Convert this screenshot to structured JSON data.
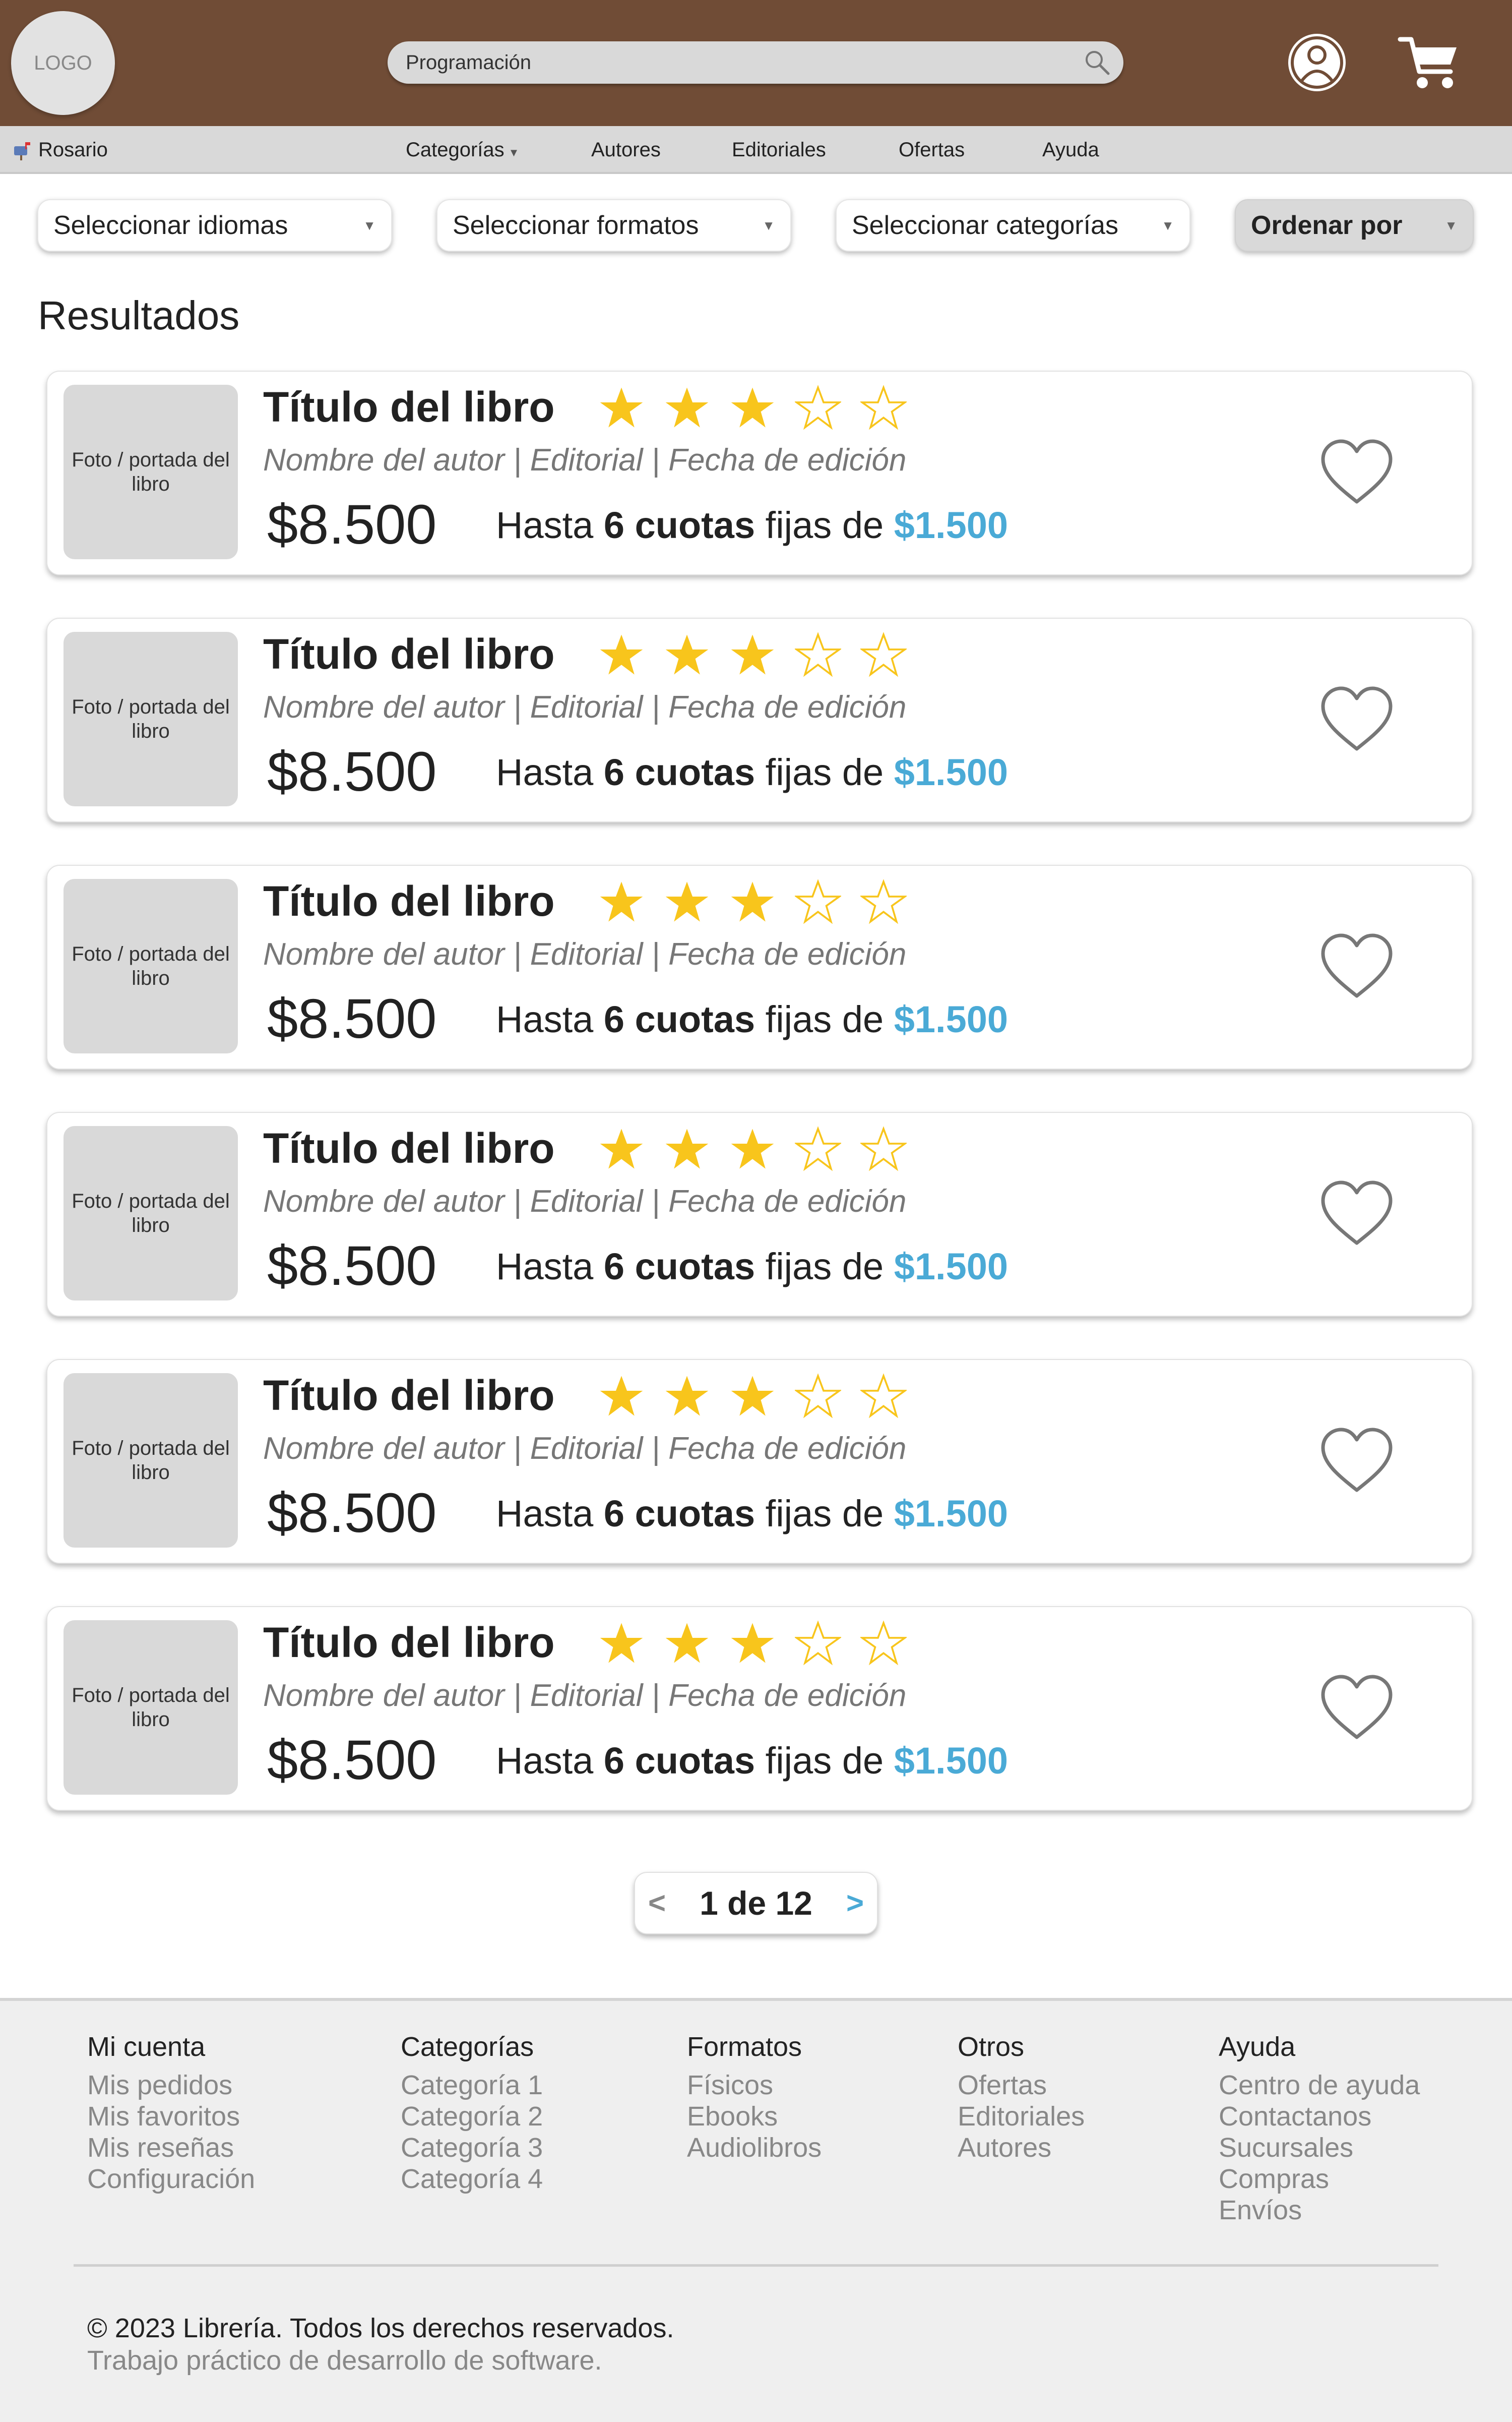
{
  "header": {
    "logo": "LOGO",
    "search_value": "Programación",
    "icons": {
      "search": "search-icon",
      "user": "user-icon",
      "cart": "cart-icon"
    },
    "background": "#704c36"
  },
  "navbar": {
    "location": "Rosario",
    "items": [
      "Categorías",
      "Autores",
      "Editoriales",
      "Ofertas",
      "Ayuda"
    ]
  },
  "filters": {
    "languages": "Seleccionar idiomas",
    "formats": "Seleccionar formatos",
    "categories": "Seleccionar categorías",
    "sort": "Ordenar por"
  },
  "results": {
    "title": "Resultados",
    "items": [
      {
        "cover": "Foto / portada del libro",
        "title": "Título del libro",
        "rating": 3,
        "rating_max": 5,
        "meta": "Nombre del autor | Editorial | Fecha de edición",
        "price": "$8.500",
        "inst_prefix": "Hasta",
        "inst_count": "6 cuotas",
        "inst_mid": "fijas de",
        "inst_amount": "$1.500"
      },
      {
        "cover": "Foto / portada del libro",
        "title": "Título del libro",
        "rating": 3,
        "rating_max": 5,
        "meta": "Nombre del autor | Editorial | Fecha de edición",
        "price": "$8.500",
        "inst_prefix": "Hasta",
        "inst_count": "6 cuotas",
        "inst_mid": "fijas de",
        "inst_amount": "$1.500"
      },
      {
        "cover": "Foto / portada del libro",
        "title": "Título del libro",
        "rating": 3,
        "rating_max": 5,
        "meta": "Nombre del autor | Editorial | Fecha de edición",
        "price": "$8.500",
        "inst_prefix": "Hasta",
        "inst_count": "6 cuotas",
        "inst_mid": "fijas de",
        "inst_amount": "$1.500"
      },
      {
        "cover": "Foto / portada del libro",
        "title": "Título del libro",
        "rating": 3,
        "rating_max": 5,
        "meta": "Nombre del autor | Editorial | Fecha de edición",
        "price": "$8.500",
        "inst_prefix": "Hasta",
        "inst_count": "6 cuotas",
        "inst_mid": "fijas de",
        "inst_amount": "$1.500"
      },
      {
        "cover": "Foto / portada del libro",
        "title": "Título del libro",
        "rating": 3,
        "rating_max": 5,
        "meta": "Nombre del autor | Editorial | Fecha de edición",
        "price": "$8.500",
        "inst_prefix": "Hasta",
        "inst_count": "6 cuotas",
        "inst_mid": "fijas de",
        "inst_amount": "$1.500"
      },
      {
        "cover": "Foto / portada del libro",
        "title": "Título del libro",
        "rating": 3,
        "rating_max": 5,
        "meta": "Nombre del autor | Editorial | Fecha de edición",
        "price": "$8.500",
        "inst_prefix": "Hasta",
        "inst_count": "6 cuotas",
        "inst_mid": "fijas de",
        "inst_amount": "$1.500"
      }
    ]
  },
  "pagination": {
    "prev": "<",
    "label": "1 de 12",
    "next": ">"
  },
  "footer": {
    "columns": [
      {
        "title": "Mi cuenta",
        "links": [
          "Mis pedidos",
          "Mis favoritos",
          "Mis reseñas",
          "Configuración"
        ]
      },
      {
        "title": "Categorías",
        "links": [
          "Categoría 1",
          "Categoría 2",
          "Categoría 3",
          "Categoría 4"
        ]
      },
      {
        "title": "Formatos",
        "links": [
          "Físicos",
          "Ebooks",
          "Audiolibros"
        ]
      },
      {
        "title": "Otros",
        "links": [
          "Ofertas",
          "Editoriales",
          "Autores"
        ]
      },
      {
        "title": "Ayuda",
        "links": [
          "Centro de ayuda",
          "Contactanos",
          "Sucursales",
          "Compras",
          "Envíos"
        ]
      }
    ],
    "copyright": "© 2023 Librería. Todos los derechos reservados.",
    "subtitle": "Trabajo práctico de desarrollo de software."
  },
  "colors": {
    "accent": "#4aaad6",
    "star": "#f8c51c",
    "header": "#704c36"
  }
}
